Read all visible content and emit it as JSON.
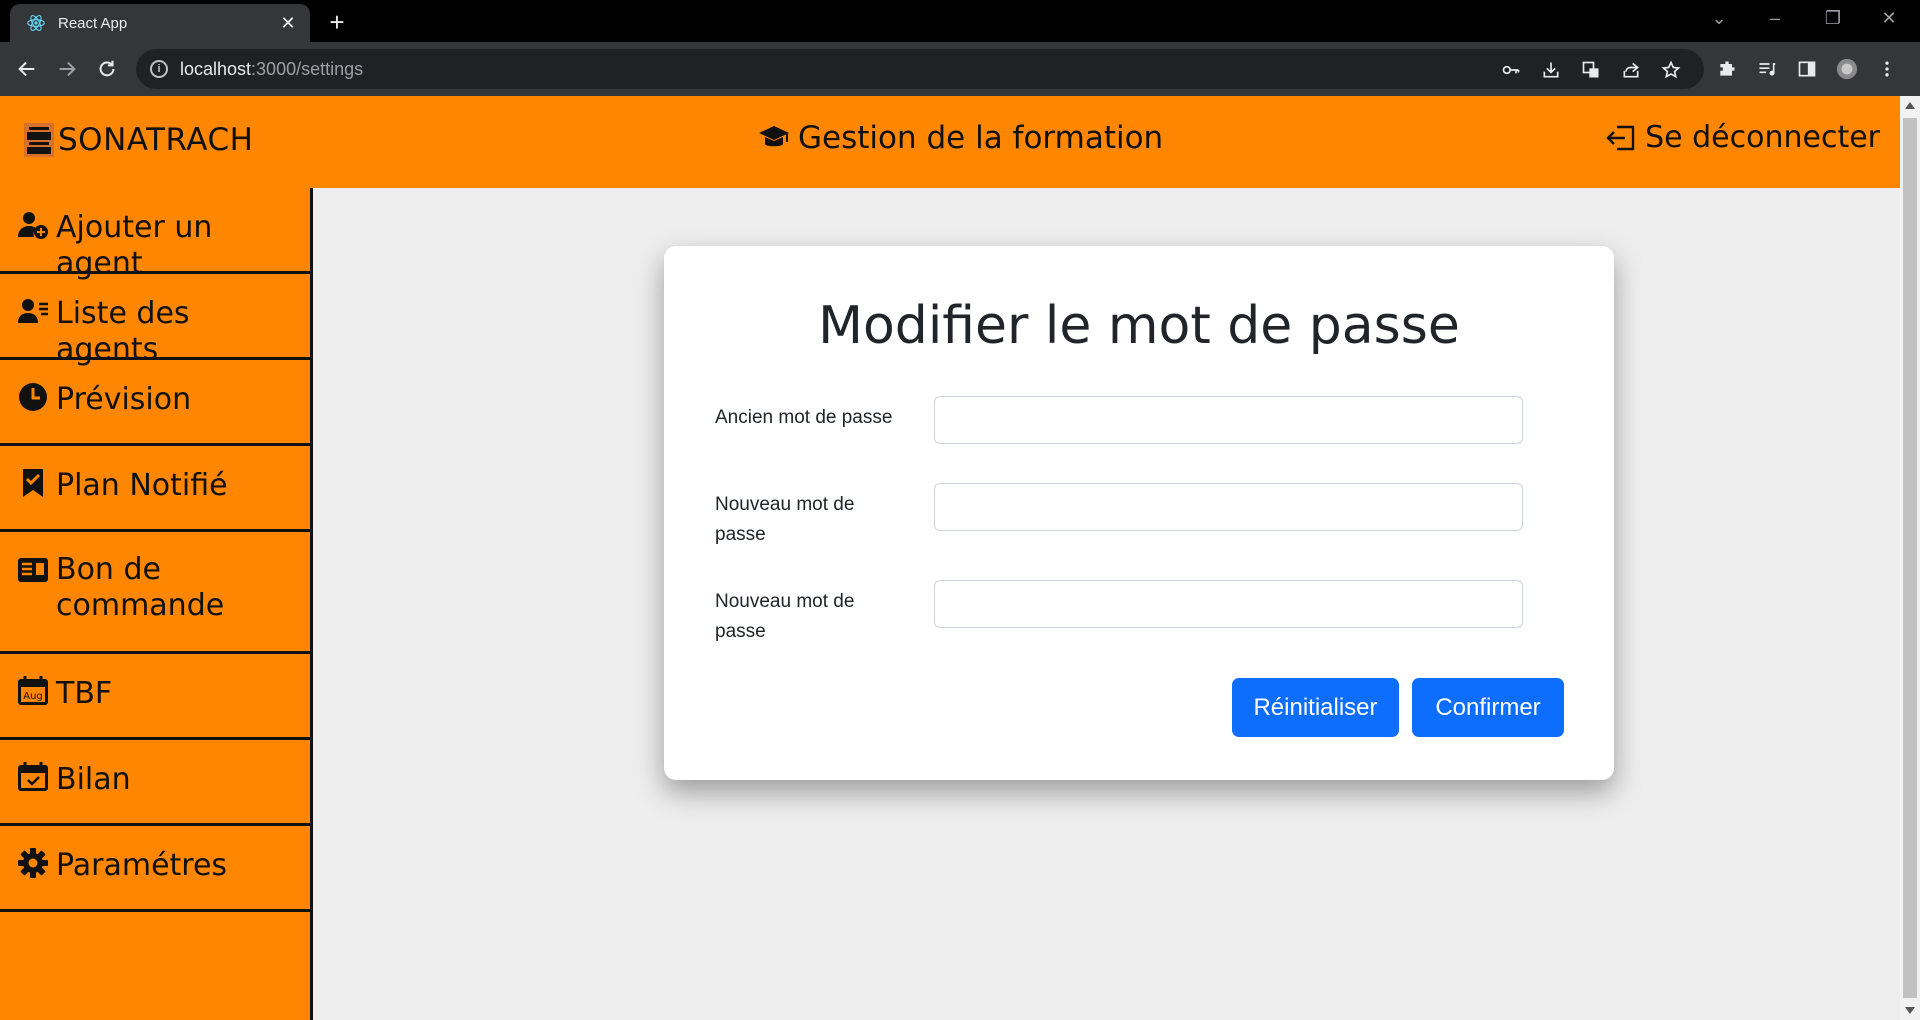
{
  "browser": {
    "tab_title": "React App",
    "url_host": "localhost",
    "url_path": ":3000/settings"
  },
  "header": {
    "brand": "SONATRACH",
    "title": "Gestion de la formation",
    "logout": "Se déconnecter"
  },
  "sidebar": {
    "items": [
      {
        "label": "Ajouter un agent",
        "icon": "user-plus-icon"
      },
      {
        "label": "Liste des agents",
        "icon": "user-list-icon"
      },
      {
        "label": "Prévision",
        "icon": "clock-icon"
      },
      {
        "label": "Plan Notifié",
        "icon": "bookmark-check-icon"
      },
      {
        "label": "Bon de commande",
        "icon": "card-list-icon"
      },
      {
        "label": "TBF",
        "icon": "calendar-aug-icon"
      },
      {
        "label": "Bilan",
        "icon": "calendar-check-icon"
      },
      {
        "label": "Paramétres",
        "icon": "gear-icon"
      }
    ]
  },
  "form": {
    "title": "Modifier le mot de passe",
    "fields": [
      {
        "label": "Ancien mot de passe",
        "value": ""
      },
      {
        "label": "Nouveau mot de passe",
        "value": ""
      },
      {
        "label": "Nouveau mot de passe",
        "value": ""
      }
    ],
    "reset_label": "Réinitialiser",
    "confirm_label": "Confirmer"
  },
  "colors": {
    "accent": "#ff8600",
    "button": "#0d6efd"
  }
}
